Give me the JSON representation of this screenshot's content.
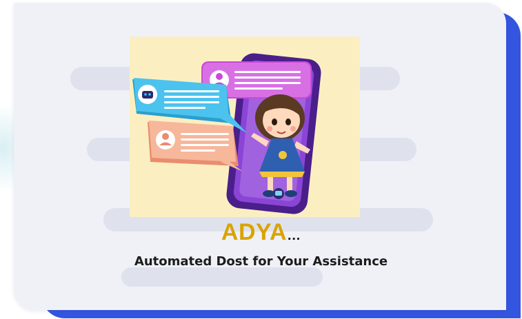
{
  "slide": {
    "brand_name": "ADYA",
    "brand_suffix": "…",
    "tagline": "Automated Dost for Your Assistance"
  },
  "colors": {
    "card_background": "#eff1f7",
    "card_accent": "#3455e0",
    "brand": "#d9a400",
    "tagline": "#1c1c1c",
    "illustration_background": "#fbefc1",
    "phone": "#6a2fb0"
  },
  "illustration": {
    "subject": "girl-stepping-out-of-smartphone-with-chat-bubbles",
    "chat_bubbles": [
      {
        "sender": "user-icon",
        "color": "#c94ad8"
      },
      {
        "sender": "robot-icon",
        "color": "#3ab7e4"
      },
      {
        "sender": "user-icon",
        "color": "#f2a88a"
      }
    ]
  }
}
